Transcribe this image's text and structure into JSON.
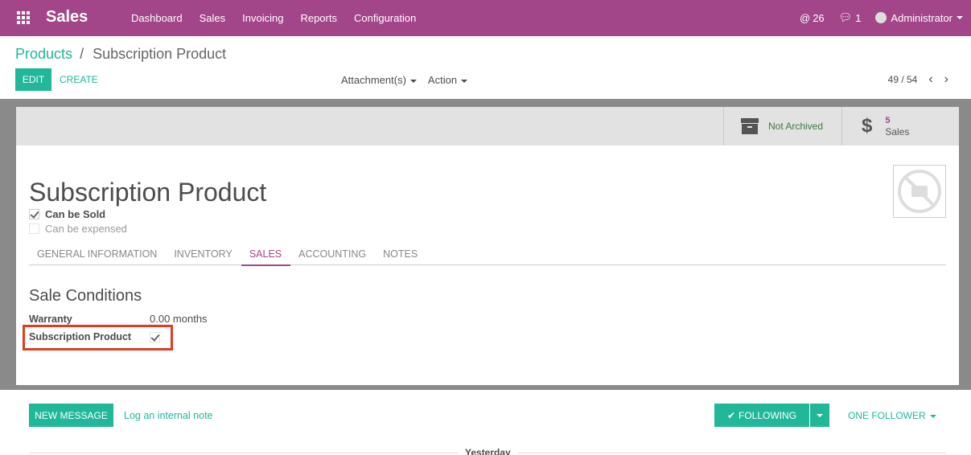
{
  "topbar": {
    "app_name": "Sales",
    "menu": [
      "Dashboard",
      "Sales",
      "Invoicing",
      "Reports",
      "Configuration"
    ],
    "mentions_count": "26",
    "messages_count": "1",
    "user": "Administrator",
    "bg_color": "#a24689"
  },
  "control_panel": {
    "breadcrumb_parent": "Products",
    "breadcrumb_separator": "/",
    "breadcrumb_current": "Subscription Product",
    "edit_label": "EDIT",
    "create_label": "CREATE",
    "attachments_label": "Attachment(s)",
    "action_label": "Action",
    "pager": "49 / 54"
  },
  "form": {
    "stat_archive_label": "Not Archived",
    "stat_sales_count": "5",
    "stat_sales_label": "Sales",
    "title": "Subscription Product",
    "can_be_sold_label": "Can be Sold",
    "can_be_sold": true,
    "can_be_expensed_label": "Can be expensed",
    "can_be_expensed": false,
    "tabs": [
      "GENERAL INFORMATION",
      "INVENTORY",
      "SALES",
      "ACCOUNTING",
      "NOTES"
    ],
    "active_tab": "SALES",
    "section_title": "Sale Conditions",
    "warranty_label": "Warranty",
    "warranty_value": "0.00 months",
    "subscription_label": "Subscription Product",
    "subscription_checked": true
  },
  "chatter": {
    "new_message_label": "NEW MESSAGE",
    "log_note_label": "Log an internal note",
    "following_label": "FOLLOWING",
    "followers_label": "ONE FOLLOWER",
    "date_separator": "Yesterday"
  },
  "colors": {
    "accent": "#21b799",
    "brand": "#a24689",
    "highlight": "#e03c1e"
  }
}
